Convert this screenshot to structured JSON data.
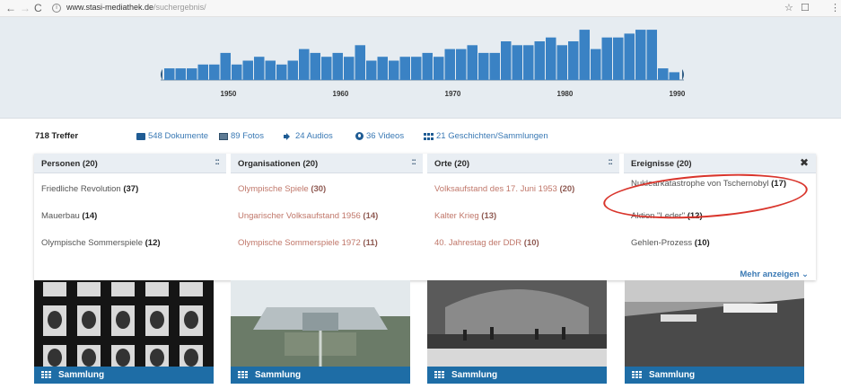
{
  "browser": {
    "back_icon": "←",
    "forward_icon": "→",
    "reload_icon": "C",
    "info_icon": "i",
    "url_host": "www.stasi-mediathek.de",
    "url_path": "/suchergebnis/",
    "right_icons": [
      "☆",
      "☐",
      "⋮"
    ]
  },
  "timeline": {
    "labels": [
      "1950",
      "1960",
      "1970",
      "1980",
      "1990"
    ],
    "bar_color": "#3a82c4",
    "background": "#e6ecf1"
  },
  "chart_data": {
    "type": "bar",
    "x_start": 1945,
    "values": [
      3,
      3,
      3,
      4,
      4,
      7,
      4,
      5,
      6,
      5,
      4,
      5,
      8,
      7,
      6,
      7,
      6,
      9,
      5,
      6,
      5,
      6,
      6,
      7,
      6,
      8,
      8,
      9,
      7,
      7,
      10,
      9,
      9,
      10,
      11,
      9,
      10,
      13,
      8,
      11,
      11,
      12,
      13,
      13,
      3,
      2
    ],
    "ticks": [
      "1950",
      "1960",
      "1970",
      "1980",
      "1990"
    ],
    "xlim": [
      1945,
      1991
    ]
  },
  "counts": {
    "total": "718 Treffer",
    "documents": "548 Dokumente",
    "photos": "89 Fotos",
    "audios": "24 Audios",
    "videos": "36 Videos",
    "stories": "21 Geschichten/Sammlungen"
  },
  "facets": {
    "personen": {
      "title": "Personen (20)",
      "items": [
        {
          "label": "Friedliche Revolution ",
          "count": "(37)"
        },
        {
          "label": "Mauerbau ",
          "count": "(14)"
        },
        {
          "label": "Olympische Sommerspiele ",
          "count": "(12)"
        }
      ]
    },
    "organisationen": {
      "title": "Organisationen (20)",
      "items": [
        {
          "label": "Olympische Spiele ",
          "count": "(30)"
        },
        {
          "label": "Ungarischer Volksaufstand 1956 ",
          "count": "(14)"
        },
        {
          "label": "Olympische Sommerspiele 1972 ",
          "count": "(11)"
        }
      ]
    },
    "orte": {
      "title": "Orte (20)",
      "items": [
        {
          "label": "Volksaufstand des 17. Juni 1953 ",
          "count": "(20)"
        },
        {
          "label": "Kalter Krieg ",
          "count": "(13)"
        },
        {
          "label": "40. Jahrestag der DDR ",
          "count": "(10)"
        }
      ]
    },
    "ereignisse": {
      "title": "Ereignisse (20)",
      "items": [
        {
          "label": "Nuklearkatastrophe von Tschernobyl ",
          "count": "(17)"
        },
        {
          "label": "Aktion \"Leder\" ",
          "count": "(12)"
        },
        {
          "label": "Gehlen-Prozess ",
          "count": "(10)"
        }
      ],
      "close_icon": "✖"
    },
    "handle_icon": "::",
    "more_label": "Mehr anzeigen",
    "more_icon": "⌄"
  },
  "cards": [
    {
      "label": "Sammlung"
    },
    {
      "label": "Sammlung"
    },
    {
      "label": "Sammlung"
    },
    {
      "label": "Sammlung"
    }
  ],
  "colors": {
    "accent_blue": "#1e6da6",
    "link_blue": "#3a79b4",
    "annotation_red": "#d9352c"
  }
}
